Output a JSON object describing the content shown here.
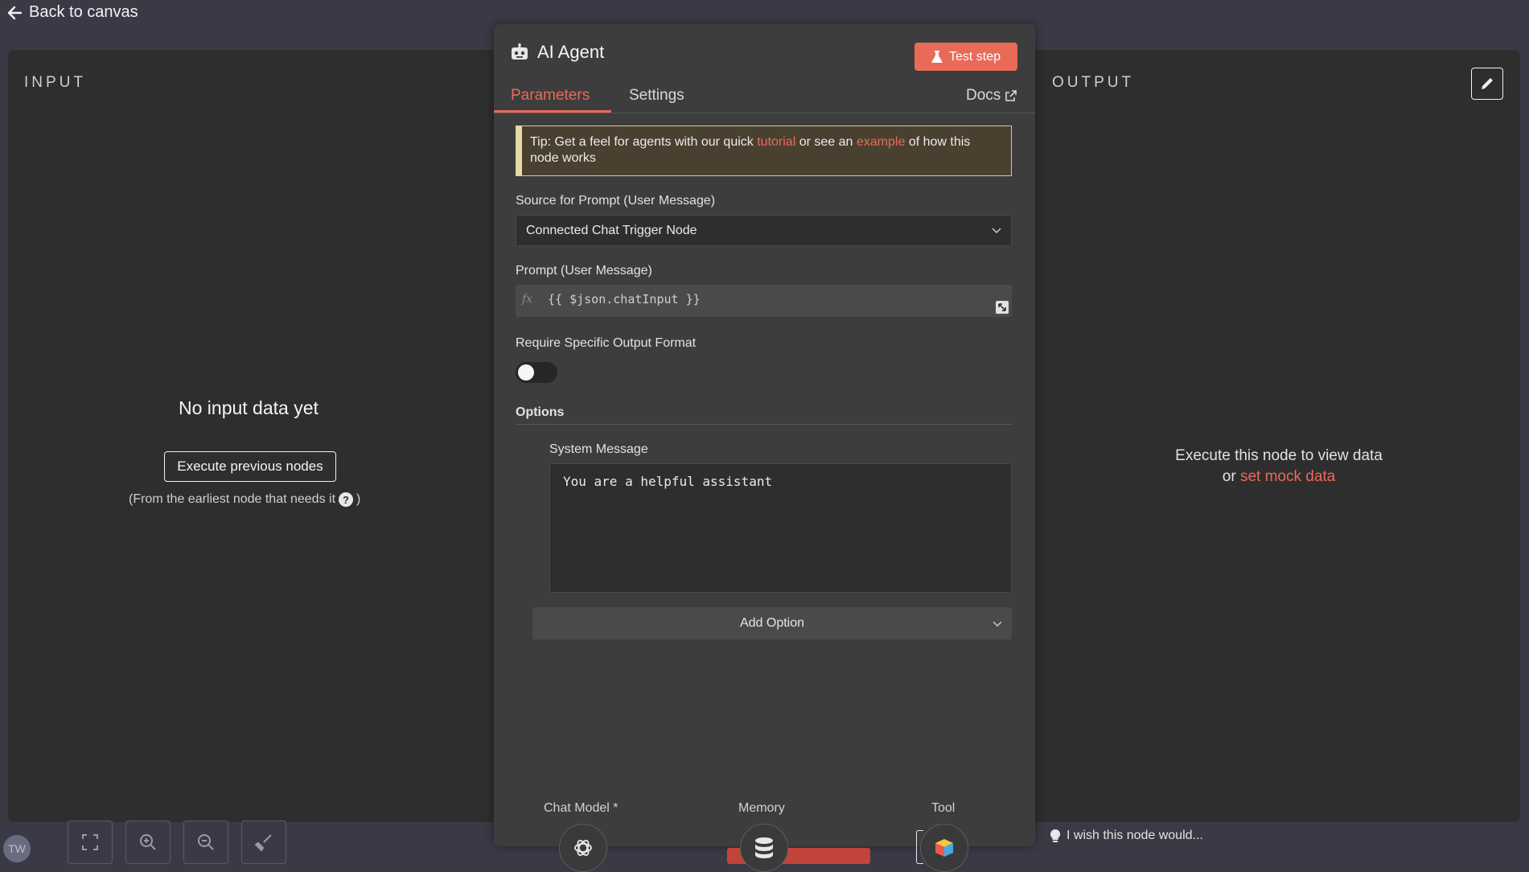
{
  "nav": {
    "back_label": "Back to canvas"
  },
  "input_panel": {
    "label": "INPUT",
    "empty_title": "No input data yet",
    "execute_button": "Execute previous nodes",
    "hint_prefix": "(From the earliest node that needs it",
    "hint_suffix": ")"
  },
  "node": {
    "title": "AI Agent",
    "test_button": "Test step",
    "tabs": [
      {
        "label": "Parameters",
        "active": true
      },
      {
        "label": "Settings",
        "active": false
      }
    ],
    "docs_label": "Docs",
    "tip": {
      "prefix": "Tip: Get a feel for agents with our quick",
      "link1": "tutorial",
      "middle": "or see an",
      "link2": "example",
      "suffix": "of how this node works"
    },
    "source_label": "Source for Prompt (User Message)",
    "source_value": "Connected Chat Trigger Node",
    "prompt_label": "Prompt (User Message)",
    "prompt_fx": "fx",
    "prompt_value": "{{ $json.chatInput }}",
    "output_format_label": "Require Specific Output Format",
    "output_format_enabled": false,
    "options_label": "Options",
    "system_message_label": "System Message",
    "system_message_value": "You are a helpful assistant",
    "add_option_label": "Add Option",
    "sub_nodes": [
      {
        "label": "Chat Model *",
        "icon": "openai-icon"
      },
      {
        "label": "Memory",
        "icon": "database-icon"
      },
      {
        "label": "Tool",
        "icon": "cube-icon"
      }
    ]
  },
  "output_panel": {
    "label": "OUTPUT",
    "message": "Execute this node to view data",
    "or_text": "or",
    "mock_link": "set mock data",
    "wish_text": "I wish this node would..."
  },
  "avatar_initials": "TW",
  "colors": {
    "accent": "#ea6a58",
    "background": "#2e2e2e",
    "panel": "#3d3d3d"
  }
}
